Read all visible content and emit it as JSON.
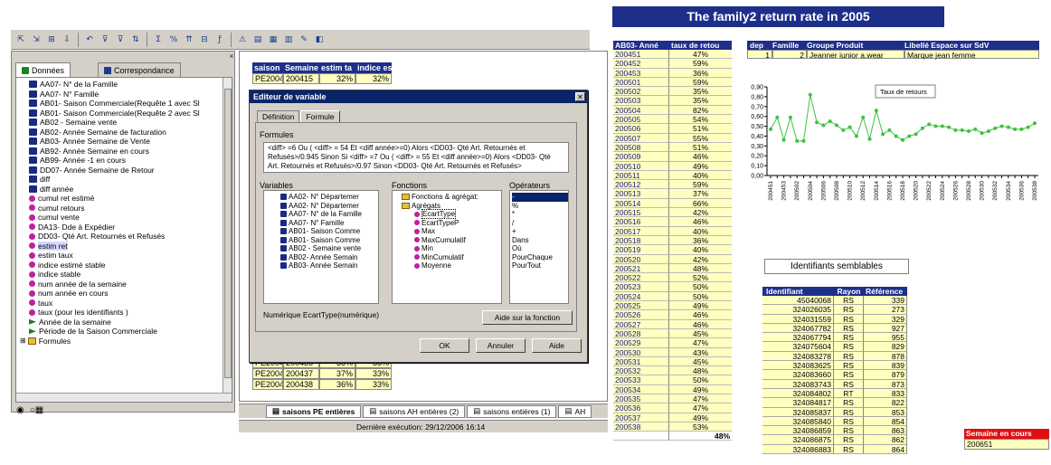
{
  "toolbar": {
    "icons": [
      "pointer-icon",
      "select-icon",
      "select-all-icon",
      "drill-icon",
      "undo-icon",
      "filter-icon",
      "filter-icon",
      "sort-icon",
      "sum-icon",
      "percent-icon",
      "rank-icon",
      "break-icon",
      "formula-icon",
      "alert-icon",
      "group-icon",
      "table-icon",
      "chart-icon",
      "edit-icon",
      "view-icon"
    ]
  },
  "left_panel": {
    "tab_donnees": "Données",
    "tab_correspondance": "Correspondance",
    "tree": [
      {
        "icon": "db",
        "label": "AA07- N° de la Famille"
      },
      {
        "icon": "db",
        "label": "AA07- N° Famille"
      },
      {
        "icon": "db",
        "label": "AB01- Saison Commerciale(Requête 1 avec Sl"
      },
      {
        "icon": "db",
        "label": "AB01- Saison Commerciale(Requête 2 avec Sl"
      },
      {
        "icon": "db",
        "label": "AB02 - Semaine vente"
      },
      {
        "icon": "db",
        "label": "AB02- Année Semaine de facturation"
      },
      {
        "icon": "db",
        "label": "AB03- Année Semaine de Vente"
      },
      {
        "icon": "db",
        "label": "AB92- Année Semaine en cours"
      },
      {
        "icon": "db",
        "label": "AB99- Année -1 en cours"
      },
      {
        "icon": "db",
        "label": "DD07- Année Semaine de Retour"
      },
      {
        "icon": "db",
        "label": "diff"
      },
      {
        "icon": "db",
        "label": "diff année"
      },
      {
        "icon": "pk",
        "label": "cumul ret estimé"
      },
      {
        "icon": "pk",
        "label": "cumul retours"
      },
      {
        "icon": "pk",
        "label": "cumul vente"
      },
      {
        "icon": "pk",
        "label": "DA13- Dde à Expédier"
      },
      {
        "icon": "pk",
        "label": "DD03- Qté Art. Retournés et Refusés"
      },
      {
        "icon": "pk",
        "label": "estim ret",
        "selected": true
      },
      {
        "icon": "pk",
        "label": "estim taux"
      },
      {
        "icon": "pk",
        "label": "indice estimé stable"
      },
      {
        "icon": "pk",
        "label": "indice stable"
      },
      {
        "icon": "pk",
        "label": "num année de la semaine"
      },
      {
        "icon": "pk",
        "label": "num année en cours"
      },
      {
        "icon": "pk",
        "label": "taux"
      },
      {
        "icon": "pk",
        "label": "taux (pour les identifiants )"
      },
      {
        "icon": "gr",
        "label": "Année de la semaine"
      },
      {
        "icon": "gr",
        "label": "Période de la Saison Commerciale"
      },
      {
        "icon": "fd",
        "label": "Formules"
      }
    ]
  },
  "sheet": {
    "headers": [
      "saison",
      "Semaine",
      "estim ta",
      "indice es"
    ],
    "top_row": [
      "PE2004",
      "200415",
      "32%",
      "32%"
    ],
    "bottom_rows": [
      [
        "PE2004",
        "200436",
        "33%",
        "33%"
      ],
      [
        "PE2004",
        "200437",
        "37%",
        "33%"
      ],
      [
        "PE2004",
        "200438",
        "36%",
        "33%"
      ]
    ],
    "tabs": [
      "saisons PE entières",
      "saisons AH entières (2)",
      "saisons entières (1)",
      "AH"
    ],
    "status": "Dernière exécution: 29/12/2006  16:14"
  },
  "dialog": {
    "title": "Editeur de variable",
    "tab_definition": "Définition",
    "tab_formule": "Formule",
    "formules_label": "Formules",
    "formula_text": "<diff> =6 Ou ( <diff> = 54  Et <diff année>=0)  Alors <DD03- Qté Art. Retournés et Refusés>/0.945 Sinon Si <diff> =7  Ou ( <diff> = 55 Et <diff année>=0) Alors <DD03- Qté Art. Retournés et Refusés>/0.97 Sinon <DD03- Qté Art. Retournés et Refusés>",
    "variables_label": "Variables",
    "fonctions_label": "Fonctions",
    "operateurs_label": "Opérateurs",
    "variables": [
      "AA02- N° Départemer",
      "AA02- N° Départemer",
      "AA07- N° de la Famille",
      "AA07- N° Famille",
      "AB01- Saison Comme",
      "AB01- Saison Comme",
      "AB02 - Semaine vente",
      "AB02- Année Semain",
      "AB03- Année Semain"
    ],
    "fonctions": [
      "Fonctions & agrégat:",
      "Agrégats",
      "EcartType",
      "EcartTypeP",
      "Max",
      "MaxCumulatif",
      "Min",
      "MinCumulatif",
      "Moyenne"
    ],
    "operateurs": [
      "-",
      "%",
      "*",
      "/",
      "+",
      "Dans",
      "Où",
      "PourChaque",
      "PourTout"
    ],
    "signature": "Numérique EcartType(numérique)",
    "help_syntax": "Aide sur la fonction",
    "ok": "OK",
    "cancel": "Annuler",
    "help": "Aide"
  },
  "report": {
    "banner": "The family2 return rate in 2005",
    "col1": "AB03- Anné",
    "col2": "taux de retou",
    "rows": [
      [
        "200451",
        "47%"
      ],
      [
        "200452",
        "59%"
      ],
      [
        "200453",
        "36%"
      ],
      [
        "200501",
        "59%"
      ],
      [
        "200502",
        "35%"
      ],
      [
        "200503",
        "35%"
      ],
      [
        "200504",
        "82%"
      ],
      [
        "200505",
        "54%"
      ],
      [
        "200506",
        "51%"
      ],
      [
        "200507",
        "55%"
      ],
      [
        "200508",
        "51%"
      ],
      [
        "200509",
        "46%"
      ],
      [
        "200510",
        "49%"
      ],
      [
        "200511",
        "40%"
      ],
      [
        "200512",
        "59%"
      ],
      [
        "200513",
        "37%"
      ],
      [
        "200514",
        "66%"
      ],
      [
        "200515",
        "42%"
      ],
      [
        "200516",
        "46%"
      ],
      [
        "200517",
        "40%"
      ],
      [
        "200518",
        "36%"
      ],
      [
        "200519",
        "40%"
      ],
      [
        "200520",
        "42%"
      ],
      [
        "200521",
        "48%"
      ],
      [
        "200522",
        "52%"
      ],
      [
        "200523",
        "50%"
      ],
      [
        "200524",
        "50%"
      ],
      [
        "200525",
        "49%"
      ],
      [
        "200526",
        "46%"
      ],
      [
        "200527",
        "46%"
      ],
      [
        "200528",
        "45%"
      ],
      [
        "200529",
        "47%"
      ],
      [
        "200530",
        "43%"
      ],
      [
        "200531",
        "45%"
      ],
      [
        "200532",
        "48%"
      ],
      [
        "200533",
        "50%"
      ],
      [
        "200534",
        "49%"
      ],
      [
        "200535",
        "47%"
      ],
      [
        "200536",
        "47%"
      ],
      [
        "200537",
        "49%"
      ],
      [
        "200538",
        "53%"
      ]
    ],
    "total": "48%",
    "fam_headers": [
      "dep",
      "Famille",
      "Groupe Produit",
      "Libellé Espace sur SdV"
    ],
    "fam_row": [
      "1",
      "2",
      "Jeanner junior a.wear",
      "Marque jean femme"
    ],
    "ident_title": "Identifiants semblables",
    "id_headers": [
      "Identifiant",
      "Rayon",
      "Référence"
    ],
    "id_rows": [
      [
        "45040068",
        "RS",
        "339"
      ],
      [
        "324026035",
        "RS",
        "273"
      ],
      [
        "324031559",
        "RS",
        "329"
      ],
      [
        "324067782",
        "RS",
        "927"
      ],
      [
        "324067794",
        "RS",
        "955"
      ],
      [
        "324075604",
        "RS",
        "829"
      ],
      [
        "324083278",
        "RS",
        "878"
      ],
      [
        "324083625",
        "RS",
        "839"
      ],
      [
        "324083660",
        "RS",
        "879"
      ],
      [
        "324083743",
        "RS",
        "873"
      ],
      [
        "324084802",
        "RT",
        "833"
      ],
      [
        "324084817",
        "RS",
        "822"
      ],
      [
        "324085837",
        "RS",
        "853"
      ],
      [
        "324085840",
        "RS",
        "854"
      ],
      [
        "324086859",
        "RS",
        "863"
      ],
      [
        "324086875",
        "RS",
        "862"
      ],
      [
        "324086883",
        "RS",
        "864"
      ]
    ],
    "sem_label": "Semaine en cours",
    "sem_value": "200651"
  },
  "chart_data": {
    "type": "line",
    "legend": "Taux de retours",
    "ylim": [
      0,
      0.9
    ],
    "yticks": [
      "0,00",
      "0,10",
      "0,20",
      "0,30",
      "0,40",
      "0,50",
      "0,60",
      "0,70",
      "0,80",
      "0,90"
    ],
    "x": [
      "200451",
      "200452",
      "200453",
      "200501",
      "200502",
      "200503",
      "200504",
      "200505",
      "200506",
      "200507",
      "200508",
      "200509",
      "200510",
      "200511",
      "200512",
      "200513",
      "200514",
      "200515",
      "200516",
      "200517",
      "200518",
      "200519",
      "200520",
      "200521",
      "200522",
      "200523",
      "200524",
      "200525",
      "200526",
      "200527",
      "200528",
      "200529",
      "200530",
      "200531",
      "200532",
      "200533",
      "200534",
      "200535",
      "200536",
      "200537",
      "200538"
    ],
    "xticks": [
      "200451",
      "200453",
      "200502",
      "200504",
      "200506",
      "200508",
      "200510",
      "200512",
      "200514",
      "200516",
      "200518",
      "200520",
      "200522",
      "200524",
      "200526",
      "200528",
      "200530",
      "200532",
      "200534",
      "200536",
      "200538"
    ],
    "values": [
      0.47,
      0.59,
      0.36,
      0.59,
      0.35,
      0.35,
      0.82,
      0.54,
      0.51,
      0.55,
      0.51,
      0.46,
      0.49,
      0.4,
      0.59,
      0.37,
      0.66,
      0.42,
      0.46,
      0.4,
      0.36,
      0.4,
      0.42,
      0.48,
      0.52,
      0.5,
      0.5,
      0.49,
      0.46,
      0.46,
      0.45,
      0.47,
      0.43,
      0.45,
      0.48,
      0.5,
      0.49,
      0.47,
      0.47,
      0.49,
      0.53
    ],
    "color": "#40c040"
  }
}
